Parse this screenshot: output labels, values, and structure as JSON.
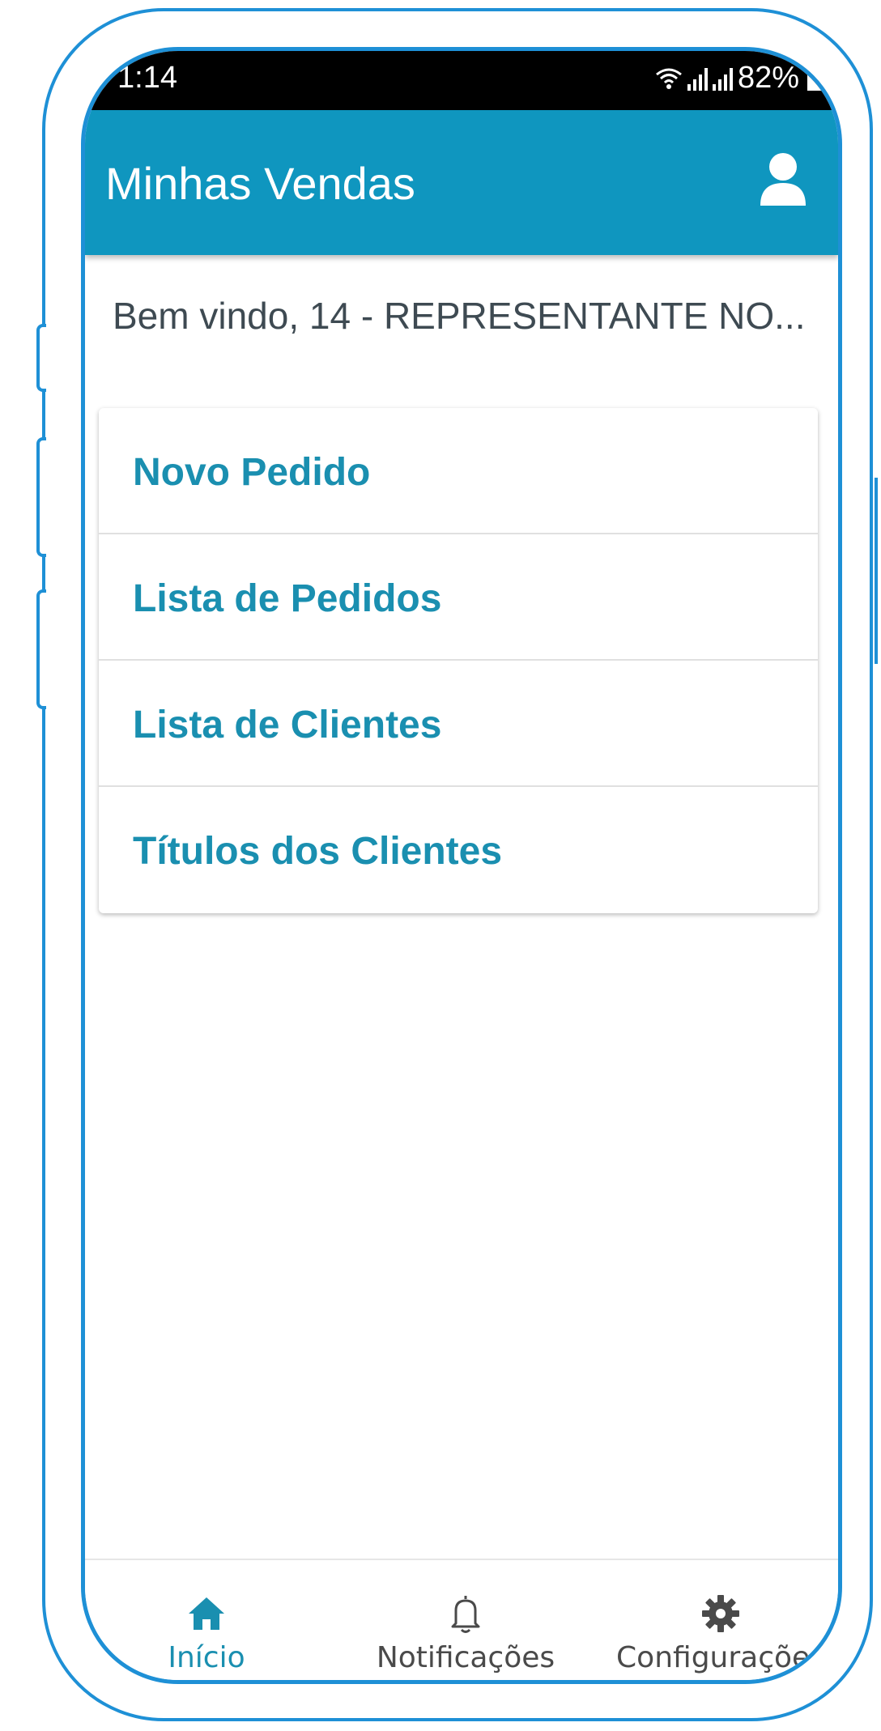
{
  "status_bar": {
    "time": "1:14",
    "battery": "82%"
  },
  "app_bar": {
    "title": "Minhas Vendas",
    "profile_icon": "person-icon"
  },
  "welcome_text": "Bem vindo, 14 - REPRESENTANTE NO...",
  "menu": {
    "items": [
      {
        "label": "Novo Pedido"
      },
      {
        "label": "Lista de Pedidos"
      },
      {
        "label": "Lista de Clientes"
      },
      {
        "label": "Títulos dos Clientes"
      }
    ]
  },
  "bottom_nav": {
    "items": [
      {
        "label": "Início",
        "icon": "home-icon",
        "active": true
      },
      {
        "label": "Notificações",
        "icon": "bell-icon",
        "active": false
      },
      {
        "label": "Configurações",
        "icon": "gear-icon",
        "active": false
      }
    ]
  },
  "colors": {
    "primary": "#0f96bf",
    "accent_text": "#1a8fb0",
    "phone_outline": "#1e90d6"
  }
}
